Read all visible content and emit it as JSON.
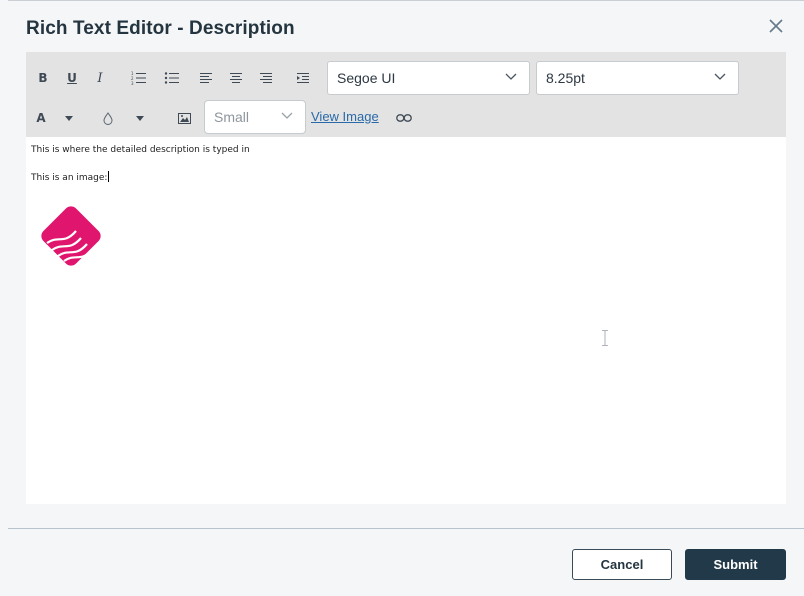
{
  "dialog": {
    "title": "Rich Text Editor - Description",
    "close_icon": "close-icon"
  },
  "toolbar": {
    "bold": "B",
    "underline": "U",
    "italic": "I",
    "font_family": "Segoe UI",
    "font_size": "8.25pt",
    "font_color_label": "A",
    "image_size": "Small",
    "view_image": "View Image",
    "icons": [
      "numbered-list-icon",
      "bullet-list-icon",
      "align-left-icon",
      "align-center-icon",
      "align-right-icon",
      "indent-icon",
      "highlight-drop-icon",
      "image-icon",
      "link-icon"
    ]
  },
  "content": {
    "line1": "This is where the detailed description is typed in",
    "line2": "This is an image:",
    "image": "logo-image",
    "logo_color": "#e0156e"
  },
  "footer": {
    "cancel": "Cancel",
    "submit": "Submit"
  },
  "colors": {
    "toolbar_bg": "#e3e3e3",
    "submit_bg": "#22394a",
    "dialog_bg": "#f4f6f7"
  }
}
